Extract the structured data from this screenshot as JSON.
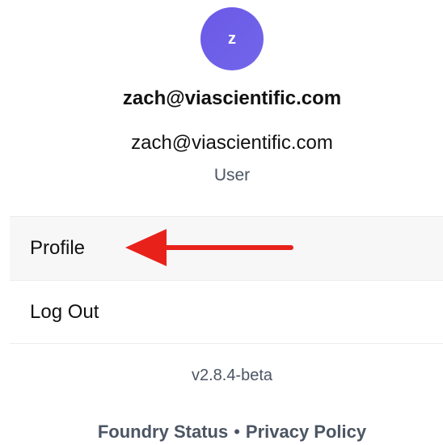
{
  "user": {
    "avatar_initial": "z",
    "display_name": "zach@viascientific.com",
    "email": "zach@viascientific.com",
    "role": "User"
  },
  "menu": {
    "items": [
      {
        "label": "Profile"
      },
      {
        "label": "Log Out"
      }
    ]
  },
  "version": "v2.8.4-beta",
  "footer": {
    "status_link": "Foundry Status",
    "separator": "•",
    "privacy_link": "Privacy Policy"
  },
  "annotation": {
    "arrow_icon": "left-arrow-icon",
    "arrow_color": "#e8221b"
  },
  "colors": {
    "avatar": "#6a59e6",
    "active_row": "#f7f7f8",
    "muted_text": "#4b5563"
  }
}
